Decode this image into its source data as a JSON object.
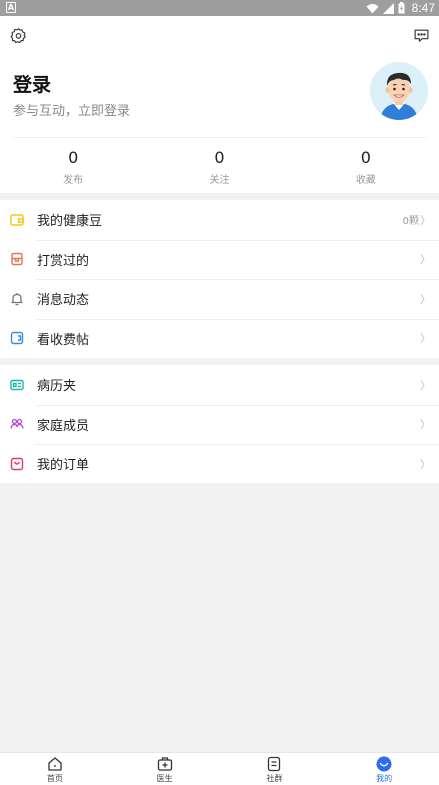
{
  "status_bar": {
    "time": "8:47",
    "left_badge": "A"
  },
  "header": {
    "login_title": "登录",
    "login_subtitle": "参与互动，立即登录",
    "stats": [
      {
        "value": "0",
        "label": "发布"
      },
      {
        "value": "0",
        "label": "关注"
      },
      {
        "value": "0",
        "label": "收藏"
      }
    ]
  },
  "menu_group_1": [
    {
      "label": "我的健康豆",
      "extra": "0颗",
      "icon": "wallet-icon",
      "color": "#f5c518"
    },
    {
      "label": "打赏过的",
      "extra": "",
      "icon": "reward-box-icon",
      "color": "#e8724f"
    },
    {
      "label": "消息动态",
      "extra": "",
      "icon": "bell-icon",
      "color": "#777777"
    },
    {
      "label": "看收费帖",
      "extra": "",
      "icon": "paid-post-icon",
      "color": "#3b8fd9"
    }
  ],
  "menu_group_2": [
    {
      "label": "病历夹",
      "extra": "",
      "icon": "medical-record-icon",
      "color": "#1bb5b0"
    },
    {
      "label": "家庭成员",
      "extra": "",
      "icon": "family-icon",
      "color": "#b046d6"
    },
    {
      "label": "我的订单",
      "extra": "",
      "icon": "order-bag-icon",
      "color": "#e33a5f"
    }
  ],
  "chevron": "〉",
  "bottom_nav": [
    {
      "label": "首页",
      "icon": "home-icon",
      "active": false
    },
    {
      "label": "医生",
      "icon": "doctor-kit-icon",
      "active": false
    },
    {
      "label": "社群",
      "icon": "community-icon",
      "active": false
    },
    {
      "label": "我的",
      "icon": "profile-smile-icon",
      "active": true
    }
  ],
  "colors": {
    "accent": "#2d6bf5",
    "background": "#f2f2f2",
    "status_bar": "#9e9e9e"
  }
}
